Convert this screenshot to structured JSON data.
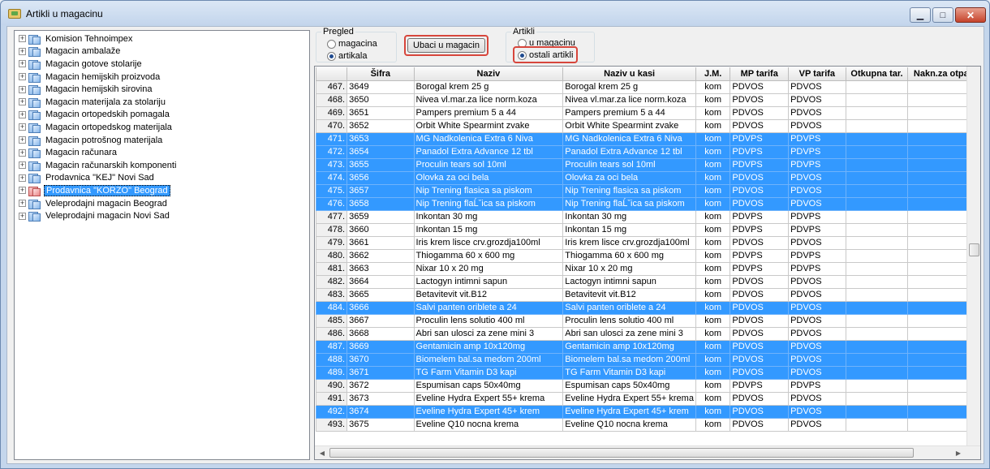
{
  "window": {
    "title": "Artikli u magacinu"
  },
  "tree": {
    "items": [
      {
        "label": "Komision Tehnoimpex",
        "selected": false
      },
      {
        "label": "Magacin ambalaže",
        "selected": false
      },
      {
        "label": "Magacin gotove stolarije",
        "selected": false
      },
      {
        "label": "Magacin hemijskih proizvoda",
        "selected": false
      },
      {
        "label": "Magacin hemijskih sirovina",
        "selected": false
      },
      {
        "label": "Magacin materijala za stolariju",
        "selected": false
      },
      {
        "label": "Magacin ortopedskih pomagala",
        "selected": false
      },
      {
        "label": "Magacin ortopedskog materijala",
        "selected": false
      },
      {
        "label": "Magacin potrošnog materijala",
        "selected": false
      },
      {
        "label": "Magacin računara",
        "selected": false
      },
      {
        "label": "Magacin računarskih komponenti",
        "selected": false
      },
      {
        "label": "Prodavnica \"KEJ\" Novi Sad",
        "selected": false
      },
      {
        "label": "Prodavnica \"KORZO\" Beograd",
        "selected": true
      },
      {
        "label": "Veleprodajni magacin Beograd",
        "selected": false
      },
      {
        "label": "Veleprodajni magacin Novi Sad",
        "selected": false
      }
    ]
  },
  "pregled": {
    "title": "Pregled",
    "option1": "magacina",
    "option2": "artikala",
    "selected": "artikala"
  },
  "ubaci_button": "Ubaci u magacin",
  "artikli": {
    "title": "Artikli",
    "option1": "u magacinu",
    "option2": "ostali artikli",
    "selected": "ostali artikli"
  },
  "grid": {
    "columns": [
      "",
      "Šifra",
      "Naziv",
      "Naziv u kasi",
      "J.M.",
      "MP tarifa",
      "VP tarifa",
      "Otkupna tar.",
      "Nakn.za otpad"
    ],
    "rows": [
      {
        "n": "467.",
        "sifra": "3649",
        "naziv": "Borogal krem 25 g",
        "kasa": "Borogal krem 25 g",
        "jm": "kom",
        "mp": "PDVOS",
        "vp": "PDVOS",
        "sel": false
      },
      {
        "n": "468.",
        "sifra": "3650",
        "naziv": "Nivea vl.mar.za lice norm.koza",
        "kasa": "Nivea vl.mar.za lice norm.koza",
        "jm": "kom",
        "mp": "PDVOS",
        "vp": "PDVOS",
        "sel": false
      },
      {
        "n": "469.",
        "sifra": "3651",
        "naziv": "Pampers premium 5 a 44",
        "kasa": "Pampers premium 5 a 44",
        "jm": "kom",
        "mp": "PDVOS",
        "vp": "PDVOS",
        "sel": false
      },
      {
        "n": "470.",
        "sifra": "3652",
        "naziv": "Orbit White Spearmint zvake",
        "kasa": "Orbit White Spearmint zvake",
        "jm": "kom",
        "mp": "PDVOS",
        "vp": "PDVOS",
        "sel": false
      },
      {
        "n": "471.",
        "sifra": "3653",
        "naziv": "MG Nadkolenica Extra 6 Niva",
        "kasa": "MG Nadkolenica Extra 6 Niva",
        "jm": "kom",
        "mp": "PDVPS",
        "vp": "PDVPS",
        "sel": true
      },
      {
        "n": "472.",
        "sifra": "3654",
        "naziv": "Panadol Extra Advance 12 tbl",
        "kasa": "Panadol Extra Advance 12 tbl",
        "jm": "kom",
        "mp": "PDVPS",
        "vp": "PDVPS",
        "sel": true
      },
      {
        "n": "473.",
        "sifra": "3655",
        "naziv": "Proculin tears sol 10ml",
        "kasa": "Proculin tears sol 10ml",
        "jm": "kom",
        "mp": "PDVPS",
        "vp": "PDVPS",
        "sel": true
      },
      {
        "n": "474.",
        "sifra": "3656",
        "naziv": "Olovka za oci bela",
        "kasa": "Olovka za oci bela",
        "jm": "kom",
        "mp": "PDVOS",
        "vp": "PDVOS",
        "sel": true
      },
      {
        "n": "475.",
        "sifra": "3657",
        "naziv": "Nip Trening flasica sa piskom",
        "kasa": "Nip Trening flasica sa piskom",
        "jm": "kom",
        "mp": "PDVOS",
        "vp": "PDVOS",
        "sel": true
      },
      {
        "n": "476.",
        "sifra": "3658",
        "naziv": "Nip Trening flaĹˇica sa piskom",
        "kasa": "Nip Trening flaĹˇica sa piskom",
        "jm": "kom",
        "mp": "PDVOS",
        "vp": "PDVOS",
        "sel": true
      },
      {
        "n": "477.",
        "sifra": "3659",
        "naziv": "Inkontan 30 mg",
        "kasa": "Inkontan 30 mg",
        "jm": "kom",
        "mp": "PDVPS",
        "vp": "PDVPS",
        "sel": false
      },
      {
        "n": "478.",
        "sifra": "3660",
        "naziv": "Inkontan 15 mg",
        "kasa": "Inkontan 15 mg",
        "jm": "kom",
        "mp": "PDVPS",
        "vp": "PDVPS",
        "sel": false
      },
      {
        "n": "479.",
        "sifra": "3661",
        "naziv": "Iris krem lisce crv.grozdja100ml",
        "kasa": "Iris krem lisce crv.grozdja100ml",
        "jm": "kom",
        "mp": "PDVOS",
        "vp": "PDVOS",
        "sel": false
      },
      {
        "n": "480.",
        "sifra": "3662",
        "naziv": "Thiogamma 60 x 600 mg",
        "kasa": "Thiogamma 60 x 600 mg",
        "jm": "kom",
        "mp": "PDVPS",
        "vp": "PDVPS",
        "sel": false
      },
      {
        "n": "481.",
        "sifra": "3663",
        "naziv": "Nixar 10 x 20 mg",
        "kasa": "Nixar 10 x 20 mg",
        "jm": "kom",
        "mp": "PDVPS",
        "vp": "PDVPS",
        "sel": false
      },
      {
        "n": "482.",
        "sifra": "3664",
        "naziv": "Lactogyn intimni sapun",
        "kasa": "Lactogyn intimni sapun",
        "jm": "kom",
        "mp": "PDVOS",
        "vp": "PDVOS",
        "sel": false
      },
      {
        "n": "483.",
        "sifra": "3665",
        "naziv": "Betavitevit vit.B12",
        "kasa": "Betavitevit vit.B12",
        "jm": "kom",
        "mp": "PDVOS",
        "vp": "PDVOS",
        "sel": false
      },
      {
        "n": "484.",
        "sifra": "3666",
        "naziv": "Salvi panten oriblete a 24",
        "kasa": "Salvi panten oriblete a 24",
        "jm": "kom",
        "mp": "PDVOS",
        "vp": "PDVOS",
        "sel": true
      },
      {
        "n": "485.",
        "sifra": "3667",
        "naziv": "Proculin lens solutio 400 ml",
        "kasa": "Proculin lens solutio 400 ml",
        "jm": "kom",
        "mp": "PDVOS",
        "vp": "PDVOS",
        "sel": false
      },
      {
        "n": "486.",
        "sifra": "3668",
        "naziv": "Abri san ulosci za zene mini 3",
        "kasa": "Abri san ulosci za zene mini 3",
        "jm": "kom",
        "mp": "PDVOS",
        "vp": "PDVOS",
        "sel": false
      },
      {
        "n": "487.",
        "sifra": "3669",
        "naziv": "Gentamicin amp 10x120mg",
        "kasa": "Gentamicin amp 10x120mg",
        "jm": "kom",
        "mp": "PDVOS",
        "vp": "PDVOS",
        "sel": true
      },
      {
        "n": "488.",
        "sifra": "3670",
        "naziv": "Biomelem bal.sa medom 200ml",
        "kasa": "Biomelem bal.sa medom 200ml",
        "jm": "kom",
        "mp": "PDVOS",
        "vp": "PDVOS",
        "sel": true
      },
      {
        "n": "489.",
        "sifra": "3671",
        "naziv": "TG Farm Vitamin D3 kapi",
        "kasa": "TG Farm Vitamin D3 kapi",
        "jm": "kom",
        "mp": "PDVOS",
        "vp": "PDVOS",
        "sel": true
      },
      {
        "n": "490.",
        "sifra": "3672",
        "naziv": "Espumisan caps 50x40mg",
        "kasa": "Espumisan caps 50x40mg",
        "jm": "kom",
        "mp": "PDVPS",
        "vp": "PDVPS",
        "sel": false
      },
      {
        "n": "491.",
        "sifra": "3673",
        "naziv": "Eveline Hydra Expert 55+  krema",
        "kasa": "Eveline Hydra Expert 55+  krema",
        "jm": "kom",
        "mp": "PDVOS",
        "vp": "PDVOS",
        "sel": false
      },
      {
        "n": "492.",
        "sifra": "3674",
        "naziv": "Eveline Hydra Expert 45+ krem",
        "kasa": "Eveline Hydra Expert 45+ krem",
        "jm": "kom",
        "mp": "PDVOS",
        "vp": "PDVOS",
        "sel": true
      },
      {
        "n": "493.",
        "sifra": "3675",
        "naziv": "Eveline Q10 nocna krema",
        "kasa": "Eveline Q10 nocna krema",
        "jm": "kom",
        "mp": "PDVOS",
        "vp": "PDVOS",
        "sel": false
      }
    ]
  },
  "icons": {
    "minimize": "minimize-icon",
    "maximize": "maximize-icon",
    "close": "close-icon",
    "scroll_left": "arrow-left-icon",
    "scroll_right": "arrow-right-icon"
  },
  "colors": {
    "selection": "#3399ff",
    "highlight_ring": "#d7463c"
  }
}
